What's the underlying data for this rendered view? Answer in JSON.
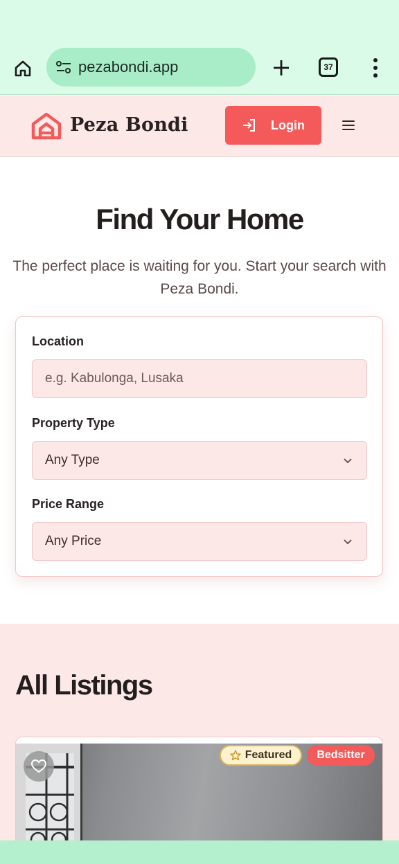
{
  "browser": {
    "url": "pezabondi.app",
    "tab_count": "37",
    "icons": {
      "home": "home-icon",
      "site_settings": "tune-icon",
      "new_tab": "plus-icon",
      "tabs": "tab-switcher-icon",
      "menu": "more-vert-icon"
    }
  },
  "header": {
    "brand": "Peza Bondi",
    "login_label": "Login",
    "icons": {
      "logo": "house-logo-icon",
      "login": "login-arrow-icon",
      "menu": "hamburger-icon"
    }
  },
  "hero": {
    "title": "Find Your Home",
    "subtitle": "The perfect place is waiting for you. Start your search with Peza Bondi."
  },
  "search": {
    "location_label": "Location",
    "location_placeholder": "e.g. Kabulonga, Lusaka",
    "property_type_label": "Property Type",
    "property_type_value": "Any Type",
    "price_range_label": "Price Range",
    "price_range_value": "Any Price"
  },
  "listings": {
    "title": "All Listings",
    "items": [
      {
        "featured_label": "Featured",
        "type_label": "Bedsitter"
      }
    ]
  },
  "colors": {
    "accent": "#f55a5a",
    "header_bg": "#fde8e8",
    "browser_bg": "#d9fbe8",
    "url_bar_bg": "#a9ecc8",
    "featured_bg": "#fdf2cf"
  }
}
